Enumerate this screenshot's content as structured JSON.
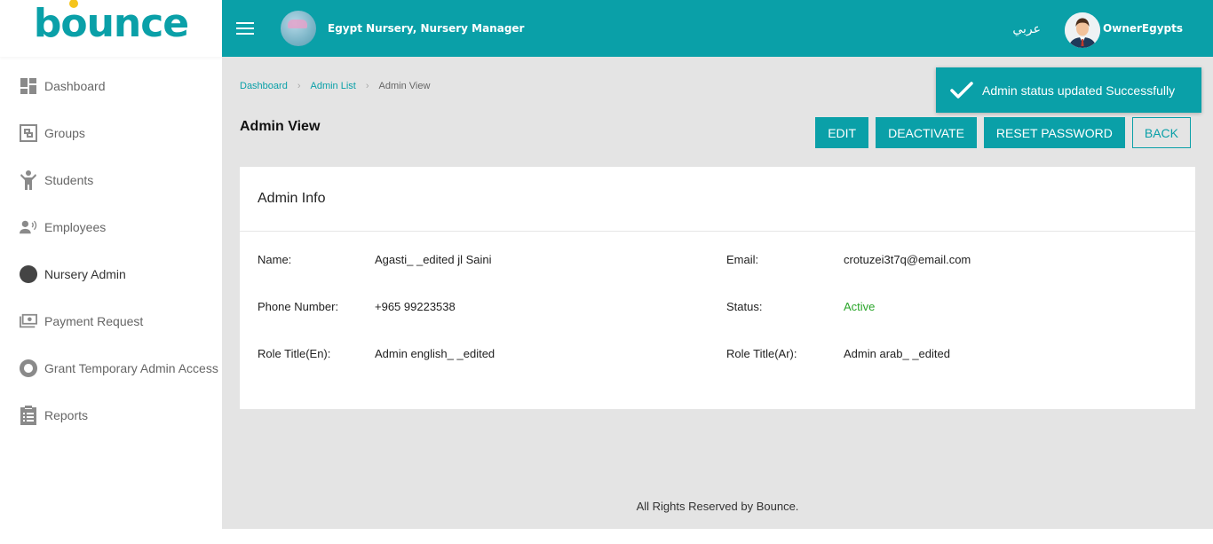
{
  "app": {
    "logo_text": "bounce"
  },
  "sidebar": {
    "items": [
      {
        "label": "Dashboard",
        "icon": "dashboard-icon"
      },
      {
        "label": "Groups",
        "icon": "groups-icon"
      },
      {
        "label": "Students",
        "icon": "students-icon"
      },
      {
        "label": "Employees",
        "icon": "employees-icon"
      },
      {
        "label": "Nursery Admin",
        "icon": "nursery-admin-icon",
        "active": true
      },
      {
        "label": "Payment Request",
        "icon": "payment-icon"
      },
      {
        "label": "Grant Temporary Admin Access",
        "icon": "lifebuoy-icon"
      },
      {
        "label": "Reports",
        "icon": "clipboard-icon"
      }
    ]
  },
  "header": {
    "org_name": "Egypt Nursery, Nursery Manager",
    "language": "عربي",
    "user_name": "OwnerEgypts",
    "accent_color": "#0aa0a8"
  },
  "breadcrumb": {
    "items": [
      "Dashboard",
      "Admin List"
    ],
    "current": "Admin View"
  },
  "page": {
    "title": "Admin View",
    "buttons": {
      "edit": "EDIT",
      "deactivate": "DEACTIVATE",
      "reset_password": "RESET PASSWORD",
      "back": "BACK"
    }
  },
  "card": {
    "title": "Admin Info",
    "fields": {
      "name_label": "Name:",
      "name_value": "Agasti_ _edited jl Saini",
      "email_label": "Email:",
      "email_value": "crotuzei3t7q@email.com",
      "phone_label": "Phone Number:",
      "phone_value": "+965 99223538",
      "status_label": "Status:",
      "status_value": "Active",
      "role_en_label": "Role Title(En):",
      "role_en_value": "Admin english_ _edited",
      "role_ar_label": "Role Title(Ar):",
      "role_ar_value": "Admin arab_ _edited"
    }
  },
  "toast": {
    "message": "Admin status updated Successfully"
  },
  "footer": {
    "text": "All Rights Reserved by Bounce."
  }
}
